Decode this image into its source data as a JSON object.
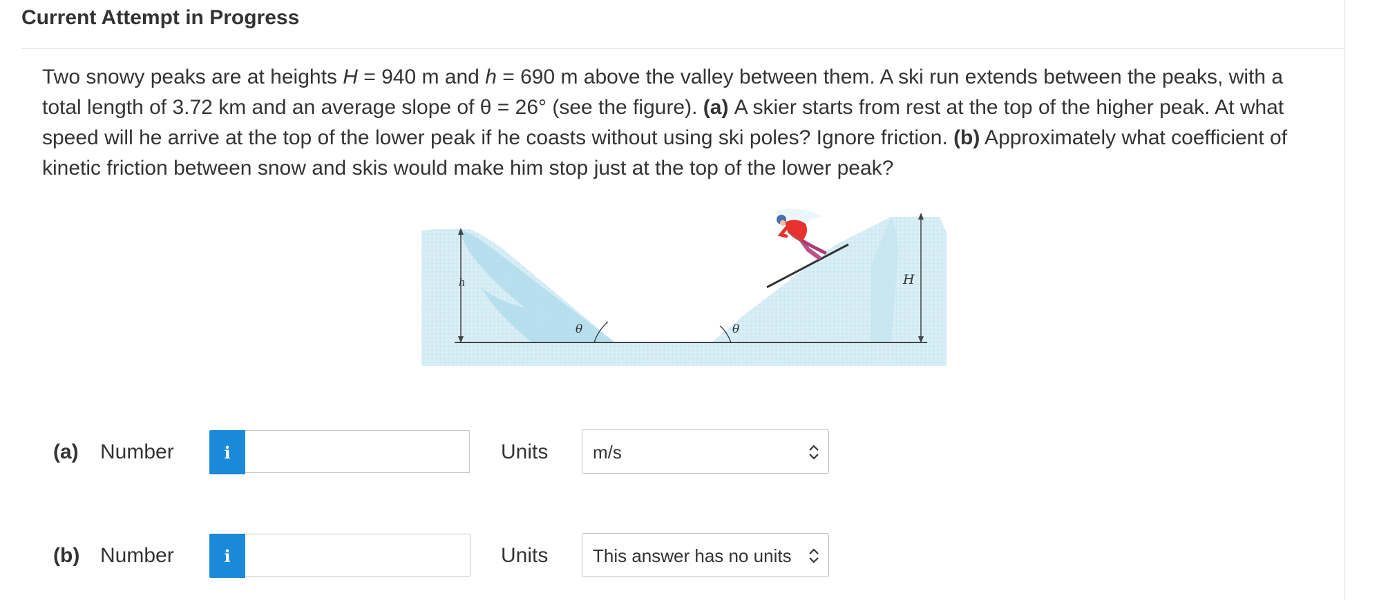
{
  "header": {
    "title": "Current Attempt in Progress"
  },
  "problem": {
    "intro_1": "Two snowy peaks are at heights ",
    "var_H": "H",
    "eq_H": " = 940 m and ",
    "var_h": "h",
    "eq_h": " = 690 m above the valley between them. A ski run extends between the peaks, with a total length of 3.72 km and an average slope of θ = 26° (see the figure). ",
    "part_a_tag": "(a)",
    "part_a_text": " A skier starts from rest at the top of the higher peak. At what speed will he arrive at the top of the lower peak if he coasts without using ski poles? Ignore friction. ",
    "part_b_tag": "(b)",
    "part_b_text": " Approximately what coefficient of kinetic friction between snow and skis would make him stop just at the top of the lower peak?"
  },
  "figure": {
    "label_h": "h",
    "label_H": "H",
    "label_theta": "θ",
    "colors": {
      "snow": "#d3ebf3",
      "slope_shadow": "#a8d7e8",
      "ground": "#4a4a4a",
      "skier_jacket": "#e8322e",
      "skier_pants": "#d04a8a"
    },
    "icons": [
      "skier-icon"
    ]
  },
  "answers": [
    {
      "part": "(a)",
      "number_label": "Number",
      "info_icon": "i",
      "value": "",
      "units_label": "Units",
      "units_selected": "m/s"
    },
    {
      "part": "(b)",
      "number_label": "Number",
      "info_icon": "i",
      "value": "",
      "units_label": "Units",
      "units_selected": "This answer has no units"
    }
  ]
}
